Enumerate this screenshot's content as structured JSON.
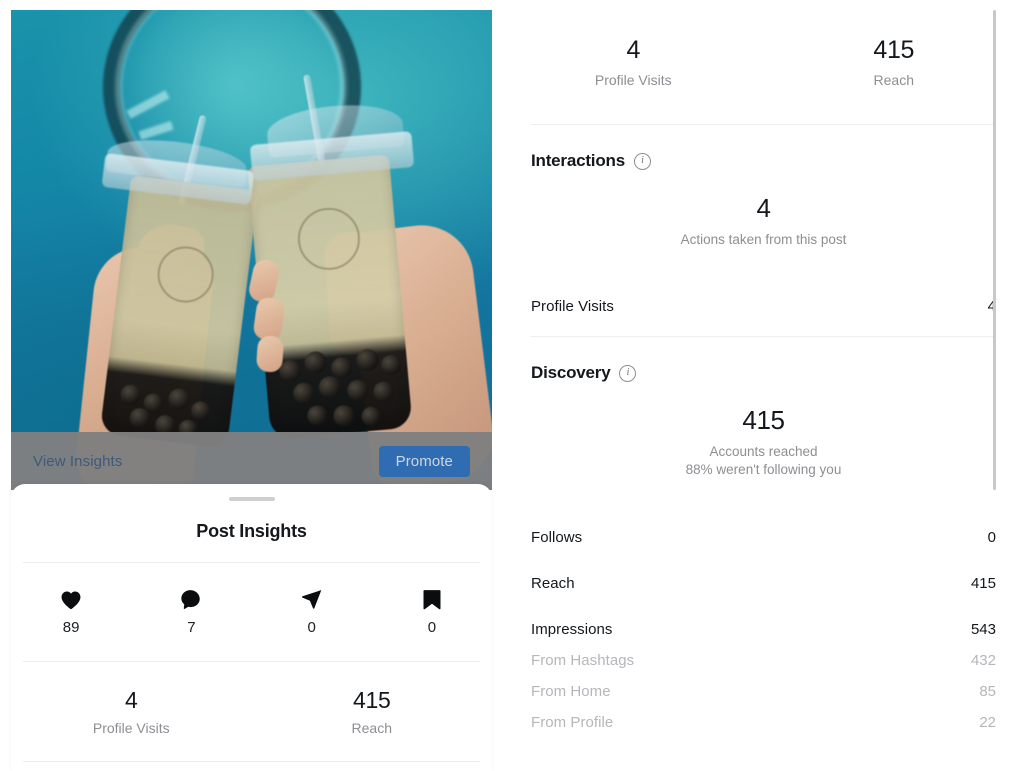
{
  "post": {
    "image_alt": "two-boba-tea-cups-held-against-teal-background",
    "overlay": {
      "view_insights_label": "View Insights",
      "promote_label": "Promote"
    }
  },
  "sheet": {
    "title": "Post Insights",
    "engagement": [
      {
        "icon": "heart-icon",
        "label": "Likes",
        "count": "89"
      },
      {
        "icon": "comment-icon",
        "label": "Comments",
        "count": "7"
      },
      {
        "icon": "share-icon",
        "label": "Shares",
        "count": "0"
      },
      {
        "icon": "bookmark-icon",
        "label": "Saves",
        "count": "0"
      }
    ],
    "summary": [
      {
        "value": "4",
        "label": "Profile Visits"
      },
      {
        "value": "415",
        "label": "Reach"
      }
    ]
  },
  "panel": {
    "summary": [
      {
        "value": "4",
        "label": "Profile Visits"
      },
      {
        "value": "415",
        "label": "Reach"
      }
    ],
    "interactions": {
      "title": "Interactions",
      "info_icon": "info-icon",
      "value": "4",
      "caption": "Actions taken from this post",
      "rows": [
        {
          "key": "Profile Visits",
          "value": "4",
          "muted": false
        }
      ]
    },
    "discovery": {
      "title": "Discovery",
      "info_icon": "info-icon",
      "value": "415",
      "caption_line1": "Accounts reached",
      "caption_line2": "88% weren't following you",
      "rows": [
        {
          "key": "Follows",
          "value": "0",
          "muted": false
        },
        {
          "key": "Reach",
          "value": "415",
          "muted": false
        },
        {
          "key": "Impressions",
          "value": "543",
          "muted": false
        },
        {
          "key": "From Hashtags",
          "value": "432",
          "muted": true
        },
        {
          "key": "From Home",
          "value": "85",
          "muted": true
        },
        {
          "key": "From Profile",
          "value": "22",
          "muted": true
        }
      ]
    }
  },
  "colors": {
    "accent_blue": "#2f6cb2",
    "link_blue": "#3d5a7a",
    "text_primary": "#14181c",
    "text_muted": "#8e8e93",
    "text_faint": "#b6b6bb",
    "overlay_gray": "#808080",
    "photo_teal": "#1487a7"
  }
}
